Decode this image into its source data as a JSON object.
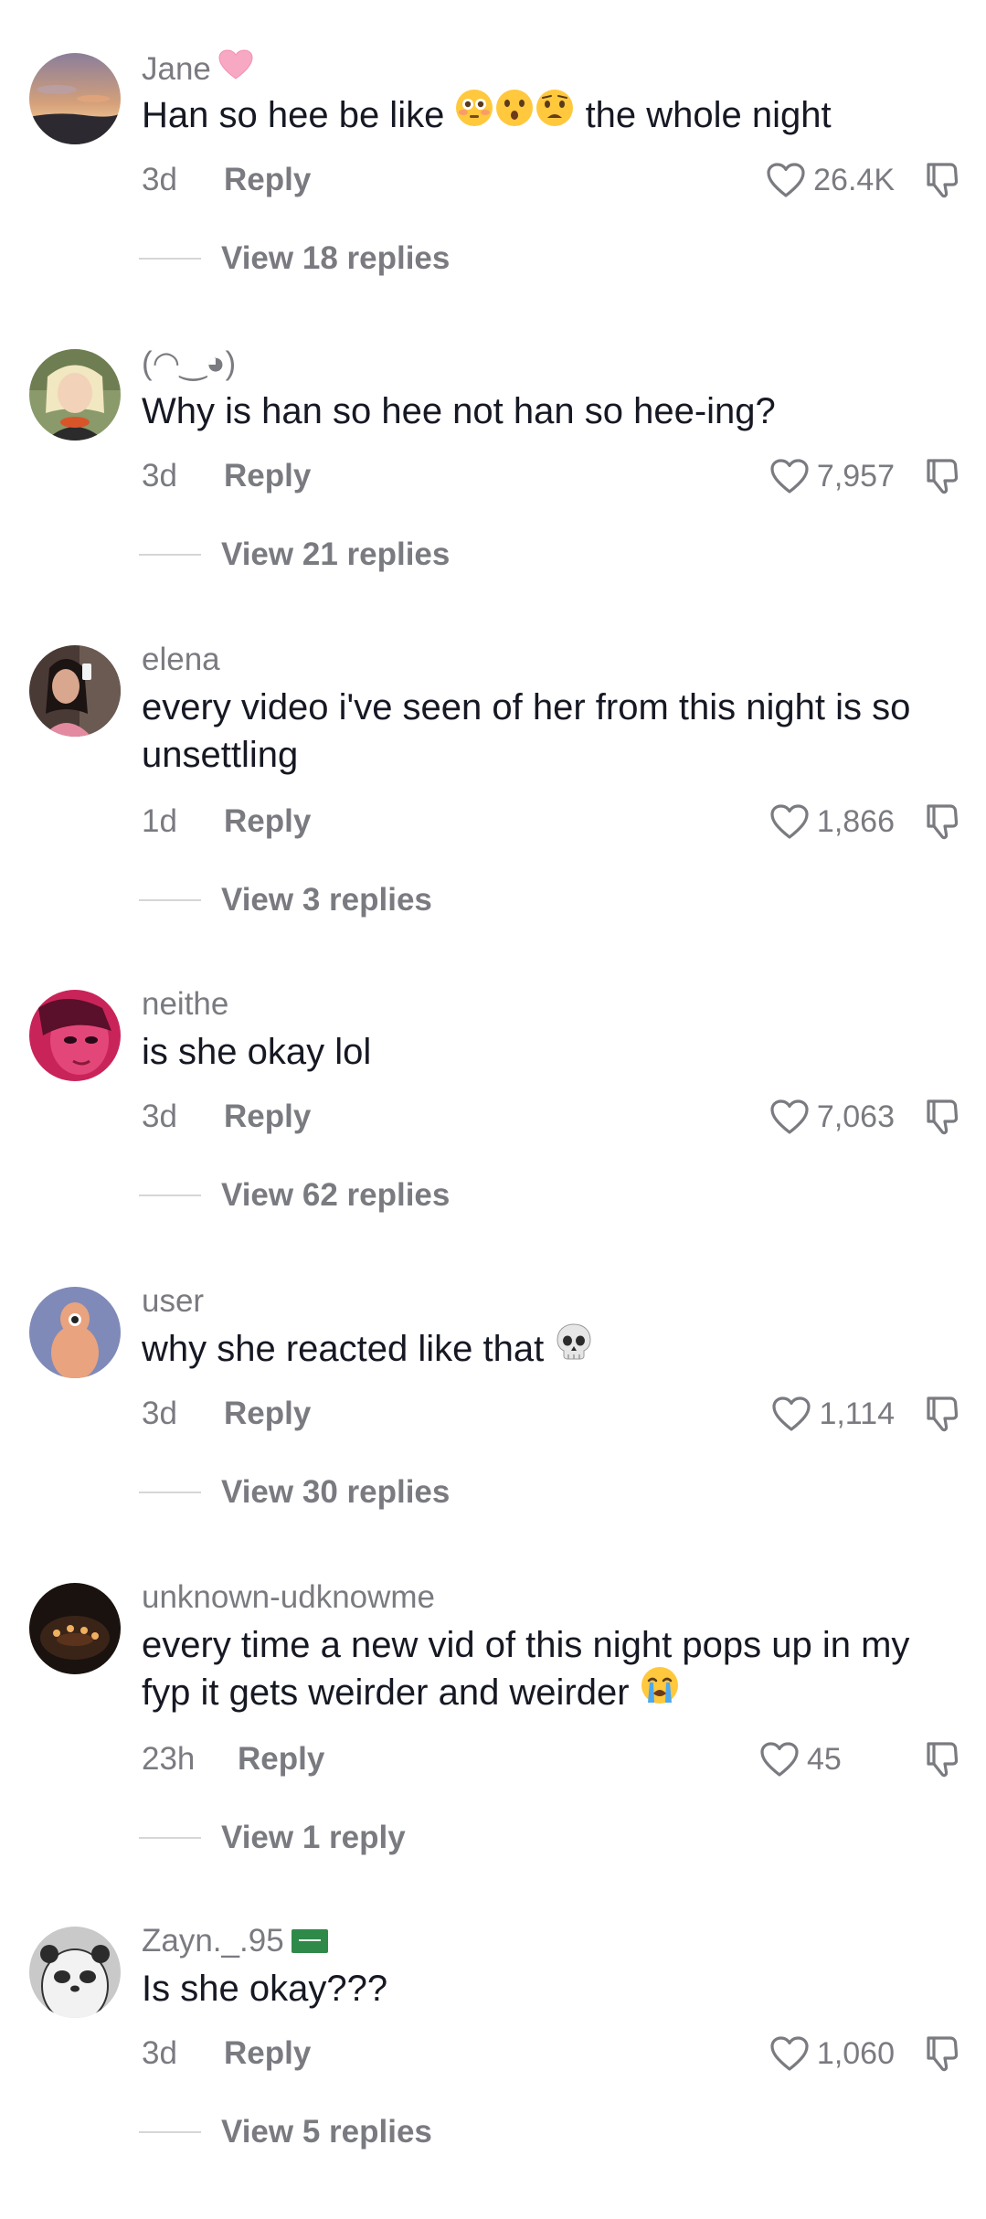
{
  "comments": [
    {
      "username": "Jane",
      "badge": "pink-heart",
      "text_before": "Han so hee be like ",
      "text_emojis": [
        "flushed-face-emoji",
        "hushed-face-emoji",
        "anguished-face-emoji"
      ],
      "text_after": " the whole night",
      "age": "3d",
      "reply": "Reply",
      "likes": "26.4K",
      "view_replies": "View 18 replies",
      "avatar": "sunset-beach"
    },
    {
      "username": "(◠‿◕)",
      "text": "Why is han so hee not han so hee-ing?",
      "age": "3d",
      "reply": "Reply",
      "likes": "7,957",
      "view_replies": "View 21 replies",
      "avatar": "blonde-person"
    },
    {
      "username": "elena",
      "text": "every video i've seen of her from this night is so unsettling",
      "age": "1d",
      "reply": "Reply",
      "likes": "1,866",
      "view_replies": "View 3 replies",
      "avatar": "mirror-selfie"
    },
    {
      "username": "neithe",
      "text": "is she okay lol",
      "age": "3d",
      "reply": "Reply",
      "likes": "7,063",
      "view_replies": "View 62 replies",
      "avatar": "pink-face"
    },
    {
      "username": "user",
      "text": "why she reacted like that ",
      "text_emoji": "skull-emoji",
      "age": "3d",
      "reply": "Reply",
      "likes": "1,114",
      "view_replies": "View 30 replies",
      "avatar": "default-user"
    },
    {
      "username": "unknown-udknowme",
      "text": "every time a new vid of this night pops up in my fyp it gets weirder and weirder ",
      "text_emoji": "loudly-crying-face-emoji",
      "age": "23h",
      "reply": "Reply",
      "likes": "45",
      "view_replies": "View 1 reply",
      "avatar": "dark-candles"
    },
    {
      "username": "Zayn._.95",
      "badge": "saudi-flag",
      "text": "Is she okay???",
      "age": "3d",
      "reply": "Reply",
      "likes": "1,060",
      "view_replies": "View 5 replies",
      "avatar": "panda-bear"
    }
  ],
  "colors": {
    "primary_text": "#161823",
    "secondary_text": "#7a7b80",
    "divider": "#d6d6d8",
    "background": "#ffffff"
  }
}
